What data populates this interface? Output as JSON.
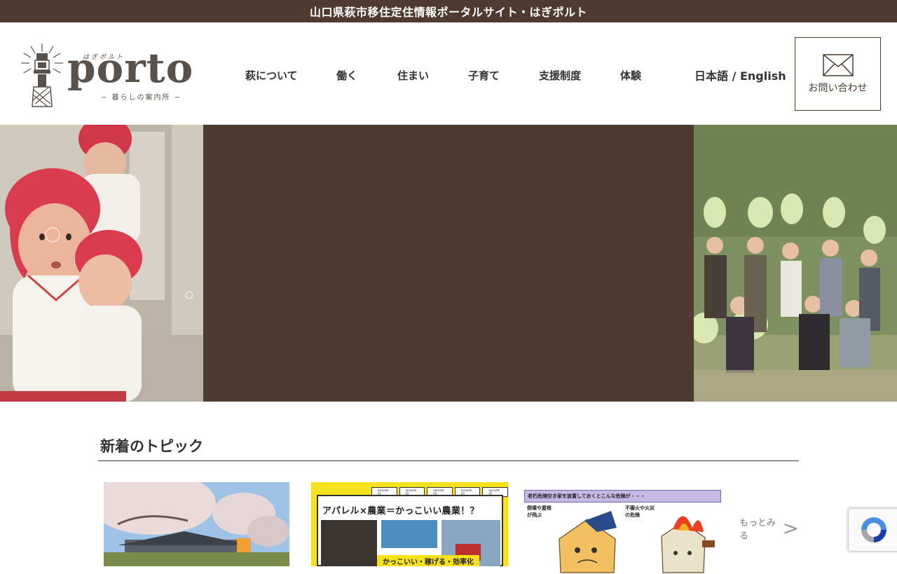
{
  "topbar": {
    "text": "山口県萩市移住定住情報ポータルサイト・はぎポルト"
  },
  "logo": {
    "word": "porto",
    "kana": "はぎポルト",
    "subtitle": "− 暮らしの案内所 −"
  },
  "nav": {
    "items": [
      {
        "label": "萩について"
      },
      {
        "label": "働く"
      },
      {
        "label": "住まい"
      },
      {
        "label": "子育て"
      },
      {
        "label": "支援制度"
      },
      {
        "label": "体験"
      }
    ],
    "language": "日本語 / English",
    "contact_label": "お問い合わせ"
  },
  "topics": {
    "title": "新着のトピック",
    "more_label": "もっとみる",
    "more_arrow": ">",
    "cards": [
      {
        "image": "cherry-blossom-house-photo"
      },
      {
        "image": "apparel-agriculture-banner",
        "tabs": [
          "episode 01",
          "episode 02",
          "episode 03",
          "episode 04",
          "episode 05"
        ],
        "headline": "アパレル×農業＝かっこいい農業！？",
        "caption": "かっこいい・稼げる・効率化"
      },
      {
        "image": "vacant-house-danger-illustration",
        "headline": "老朽危険空き家を放置しておくとこんな危険が・・・",
        "left_note": "倒壊や屋根が飛ぶ",
        "right_note": "不審火や火災の危険"
      }
    ]
  },
  "colors": {
    "brand_brown": "#4e3b2e",
    "banner_yellow": "#f6e21c"
  }
}
